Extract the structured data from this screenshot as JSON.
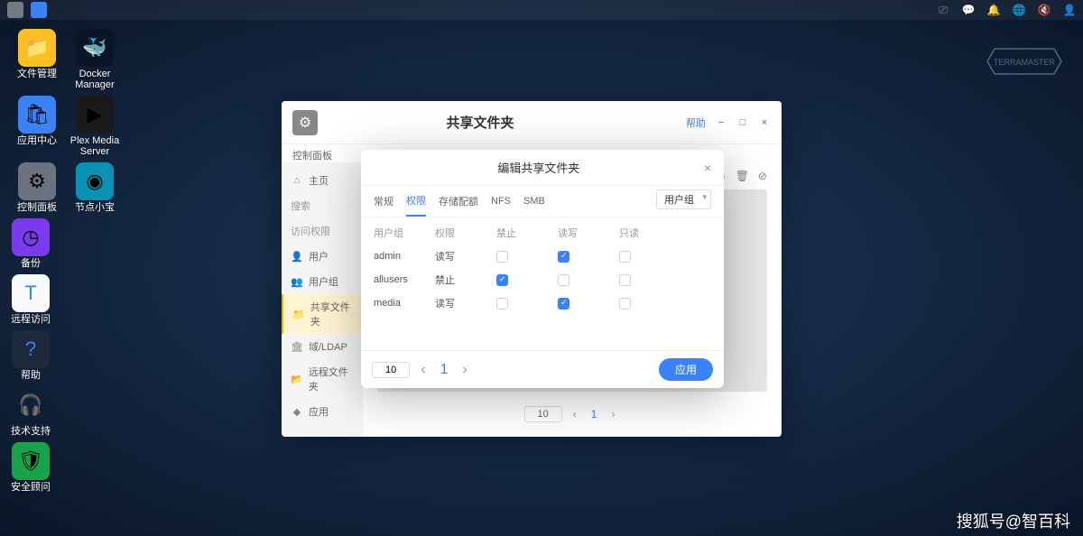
{
  "taskbar": {
    "tray": [
      "monitor",
      "chat",
      "bell",
      "globe",
      "mute",
      "user"
    ]
  },
  "desktop": {
    "row1": [
      {
        "label": "文件管理",
        "bg": "#fbbf24",
        "glyph": "📁"
      },
      {
        "label": "Docker\nManager",
        "bg": "#0a1628",
        "glyph": "🐳"
      }
    ],
    "row2": [
      {
        "label": "应用中心",
        "bg": "#3b82f6",
        "glyph": "🛍"
      },
      {
        "label": "Plex Media\nServer",
        "bg": "#1a1a1a",
        "glyph": "▶"
      }
    ],
    "row3": [
      {
        "label": "控制面板",
        "bg": "#6b7280",
        "glyph": "⚙"
      },
      {
        "label": "节点小宝",
        "bg": "#0891b2",
        "glyph": "◉"
      }
    ],
    "col": [
      {
        "label": "备份",
        "bg": "#7c3aed",
        "glyph": "◷"
      },
      {
        "label": "远程访问",
        "bg": "#f8fafc",
        "glyph": "T",
        "fg": "#3b82f6"
      },
      {
        "label": "帮助",
        "bg": "#1e293b",
        "glyph": "?",
        "fg": "#3b82f6"
      },
      {
        "label": "技术支持",
        "bg": "transparent",
        "glyph": "🎧"
      },
      {
        "label": "安全顾问",
        "bg": "#16a34a",
        "glyph": "🛡"
      }
    ]
  },
  "brand": "TERRAMASTER",
  "window": {
    "title": "共享文件夹",
    "help": "帮助",
    "breadcrumb": "控制面板",
    "sidebar": {
      "home": "主页",
      "search": "搜索",
      "accessHeader": "访问权限",
      "items": [
        {
          "label": "用户",
          "icon": "👤"
        },
        {
          "label": "用户组",
          "icon": "👥"
        },
        {
          "label": "共享文件夹",
          "icon": "📁",
          "active": true
        },
        {
          "label": "域/LDAP",
          "icon": "🏛"
        },
        {
          "label": "远程文件夹",
          "icon": "📂"
        },
        {
          "label": "应用",
          "icon": "◆"
        }
      ]
    },
    "pagination": {
      "size": "10",
      "page": "1"
    }
  },
  "modal": {
    "title": "编辑共享文件夹",
    "tabs": [
      "常规",
      "权限",
      "存储配额",
      "NFS",
      "SMB"
    ],
    "activeTab": 1,
    "selectLabel": "用户组",
    "columns": [
      "用户组",
      "权限",
      "禁止",
      "读写",
      "只读"
    ],
    "rows": [
      {
        "name": "admin",
        "perm": "读写",
        "forbid": false,
        "rw": true,
        "ro": false
      },
      {
        "name": "allusers",
        "perm": "禁止",
        "forbid": true,
        "rw": false,
        "ro": false
      },
      {
        "name": "media",
        "perm": "读写",
        "forbid": false,
        "rw": true,
        "ro": false
      }
    ],
    "pageSize": "10",
    "pageNum": "1",
    "applyLabel": "应用"
  },
  "watermark": "搜狐号@智百科"
}
